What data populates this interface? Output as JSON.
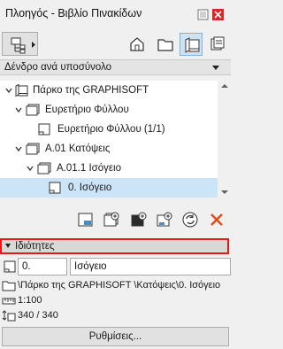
{
  "window": {
    "title": "Πλοηγός - Βιβλίο Πινακίδων"
  },
  "toolbar": {
    "modes": [
      {
        "name": "project-map",
        "icon": "house-icon",
        "active": false
      },
      {
        "name": "view-map",
        "icon": "folder-icon",
        "active": false
      },
      {
        "name": "layout-book",
        "icon": "layout-book-icon",
        "active": true
      },
      {
        "name": "publisher",
        "icon": "publisher-icon",
        "active": false
      }
    ]
  },
  "view_selector": {
    "value": "Δένδρο ανά υποσύνολο"
  },
  "tree": {
    "items": [
      {
        "label": "Πάρκο της GRAPHISOFT",
        "icon": "layout-book-icon",
        "expanded": true,
        "selected": false
      },
      {
        "label": "Ευρετήριο Φύλλου",
        "icon": "subset-icon",
        "expanded": true,
        "selected": false
      },
      {
        "label": "Ευρετήριο Φύλλου (1/1)",
        "icon": "layout-icon",
        "selected": false
      },
      {
        "label": "A.01 Κατόψεις",
        "icon": "subset-icon",
        "expanded": true,
        "selected": false
      },
      {
        "label": "A.01.1 Ισόγειο",
        "icon": "subset-icon",
        "expanded": true,
        "selected": false
      },
      {
        "label": "0. Ισόγειο",
        "icon": "layout-icon",
        "selected": true
      }
    ]
  },
  "actions": [
    {
      "name": "new-layout",
      "icon": "new-layout-icon"
    },
    {
      "name": "new-subset",
      "icon": "new-subset-icon"
    },
    {
      "name": "new-master",
      "icon": "new-master-icon"
    },
    {
      "name": "clone-layout",
      "icon": "clone-layout-icon"
    },
    {
      "name": "update",
      "icon": "refresh-icon"
    },
    {
      "name": "delete",
      "icon": "delete-icon"
    }
  ],
  "properties": {
    "header": "Ιδιότητες",
    "id_value": "0.",
    "name_value": "Ισόγειο",
    "path": "\\Πάρκο της GRAPHISOFT \\Κατόψεις\\0. Ισόγειο",
    "scale": "1:100",
    "size": "340 / 340",
    "settings_label": "Ρυθμίσεις..."
  },
  "colors": {
    "selection": "#cce4f7",
    "highlight_border": "#e81818",
    "close_button": "#d62828"
  }
}
